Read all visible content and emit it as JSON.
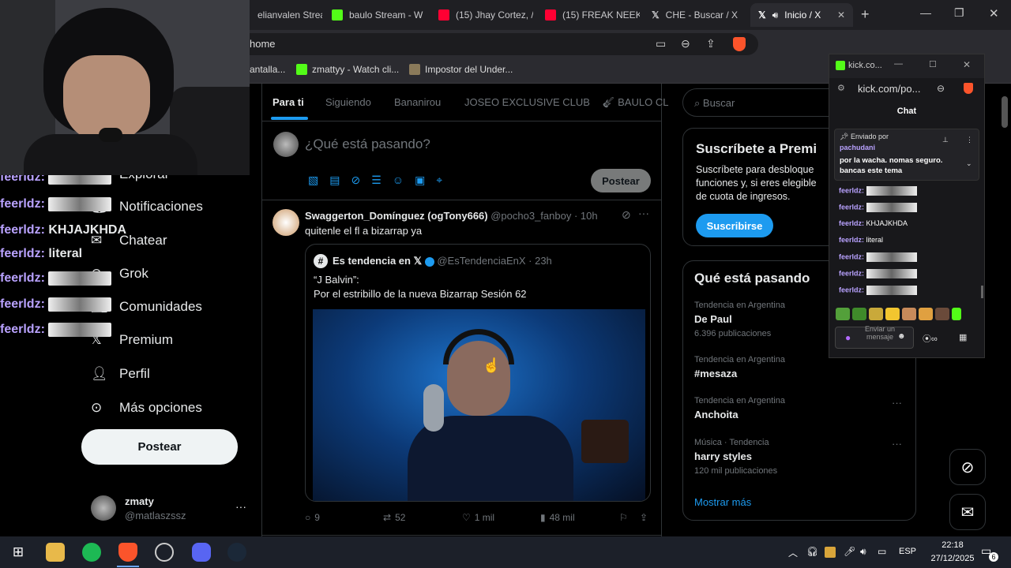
{
  "browser": {
    "tabs": [
      {
        "label": "elianvalen Strea",
        "icon": "kick"
      },
      {
        "label": "baulo Stream - W",
        "icon": "kick"
      },
      {
        "label": "(15) Jhay Cortez, /",
        "icon": "youtube"
      },
      {
        "label": "(15) FREAK NEEK",
        "icon": "youtube"
      },
      {
        "label": "CHE - Buscar / X",
        "icon": "x"
      },
      {
        "label": "Inicio / X",
        "icon": "x"
      }
    ],
    "url": "home",
    "bookmarks": [
      {
        "label": "antalla..."
      },
      {
        "label": "zmattyy - Watch cli..."
      },
      {
        "label": "Impostor del Under..."
      }
    ]
  },
  "nav": {
    "items": [
      "Explorar",
      "Notificaciones",
      "Chatear",
      "Grok",
      "Comunidades",
      "Premium",
      "Perfil",
      "Más opciones"
    ],
    "post_button": "Postear",
    "account": {
      "name": "zmaty",
      "handle": "@matlaszssz"
    }
  },
  "overlay_chat": [
    {
      "user": "feerldz:",
      "text": ""
    },
    {
      "user": "feerldz:",
      "text": ""
    },
    {
      "user": "feerldz:",
      "text": "KHJAJKHDA"
    },
    {
      "user": "feerldz:",
      "text": "literal"
    },
    {
      "user": "feerldz:",
      "text": ""
    },
    {
      "user": "feerldz:",
      "text": ""
    },
    {
      "user": "feerldz:",
      "text": ""
    }
  ],
  "feed": {
    "tabs": [
      "Para ti",
      "Siguiendo",
      "Bananirou",
      "JOSEO EXCLUSIVE CLUB",
      "BAULO CL"
    ],
    "composer_placeholder": "¿Qué está pasando?",
    "composer_button": "Postear",
    "post": {
      "name": "Swaggerton_Domínguez (ogTony666)",
      "handle": "@pocho3_fanboy · 10h",
      "text": "quitenle el fl a bizarrap ya",
      "quote": {
        "name": "Es tendencia en 𝕏",
        "handle": "@EsTendenciaEnX · 23h",
        "line1": "“J Balvin”:",
        "line2": "Por el estribillo de la nueva Bizarrap Sesión 62"
      },
      "stats": {
        "replies": "9",
        "reposts": "52",
        "likes": "1 mil",
        "views": "48 mil"
      }
    }
  },
  "sidebar": {
    "search_placeholder": "Buscar",
    "premium": {
      "title": "Suscríbete a Premi",
      "body1": "Suscríbete para desbloque",
      "body2": "funciones y, si eres elegible",
      "body3": "de cuota de ingresos.",
      "button": "Suscribirse"
    },
    "trends_title": "Qué está pasando",
    "trends": [
      {
        "meta": "Tendencia en Argentina",
        "title": "De Paul",
        "count": "6.396 publicaciones"
      },
      {
        "meta": "Tendencia en Argentina",
        "title": "#mesaza",
        "count": ""
      },
      {
        "meta": "Tendencia en Argentina",
        "title": "Anchoita",
        "count": ""
      },
      {
        "meta": "Música · Tendencia",
        "title": "harry styles",
        "count": "120 mil publicaciones"
      }
    ],
    "show_more": "Mostrar más"
  },
  "kick_popup": {
    "title": "kick.co...",
    "url": "kick.com/po...",
    "chat_title": "Chat",
    "pinned_by_label": "Enviado por",
    "pinned_user": "pachudani",
    "pinned_text": "por la wacha. nomas seguro. bancas este tema",
    "messages": [
      {
        "user": "feerldz:",
        "text": ""
      },
      {
        "user": "feerldz:",
        "text": ""
      },
      {
        "user": "feerldz:",
        "text": "KHJAJKHDA"
      },
      {
        "user": "feerldz:",
        "text": "literal"
      },
      {
        "user": "feerldz:",
        "text": ""
      },
      {
        "user": "feerldz:",
        "text": ""
      },
      {
        "user": "feerldz:",
        "text": ""
      }
    ],
    "input_placeholder": "Enviar un mensaje"
  },
  "taskbar": {
    "lang": "ESP",
    "time": "22:18",
    "date": "27/12/2025",
    "notif_count": "6"
  },
  "colors": {
    "x_blue": "#1d9bf0",
    "kick_green": "#53fc18",
    "chat_user": "#b9a2ff"
  }
}
